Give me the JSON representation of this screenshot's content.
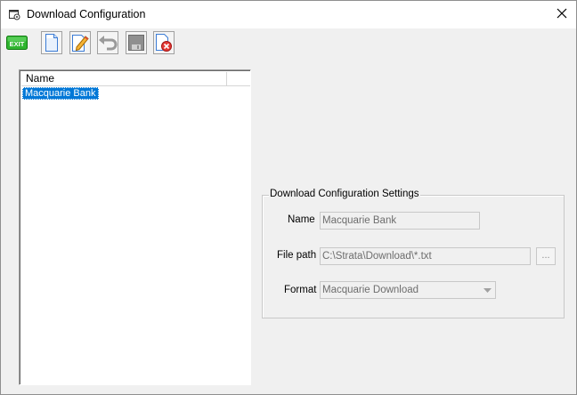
{
  "window": {
    "title": "Download Configuration"
  },
  "icons": {
    "title": "window-settings-icon",
    "close": "close-icon",
    "exit": "exit-icon",
    "new": "new-document-icon",
    "edit": "edit-icon",
    "undo": "undo-icon",
    "save": "save-icon",
    "delete": "delete-icon",
    "dropdown": "chevron-down-icon"
  },
  "toolbar": {
    "exit_label": "EXIT"
  },
  "list": {
    "columns": [
      "Name",
      ""
    ],
    "rows": [
      "Macquarie Bank"
    ],
    "selected_index": 0
  },
  "settings": {
    "group_title": "Download Configuration Settings",
    "name_label": "Name",
    "name_value": "Macquarie Bank",
    "filepath_label": "File path",
    "filepath_value": "C:\\Strata\\Download\\*.txt",
    "browse_label": "...",
    "format_label": "Format",
    "format_value": "Macquarie Download"
  },
  "colors": {
    "selection": "#0078d7",
    "window_bg": "#f0f0f0",
    "exit_green": "#2fb52f"
  }
}
